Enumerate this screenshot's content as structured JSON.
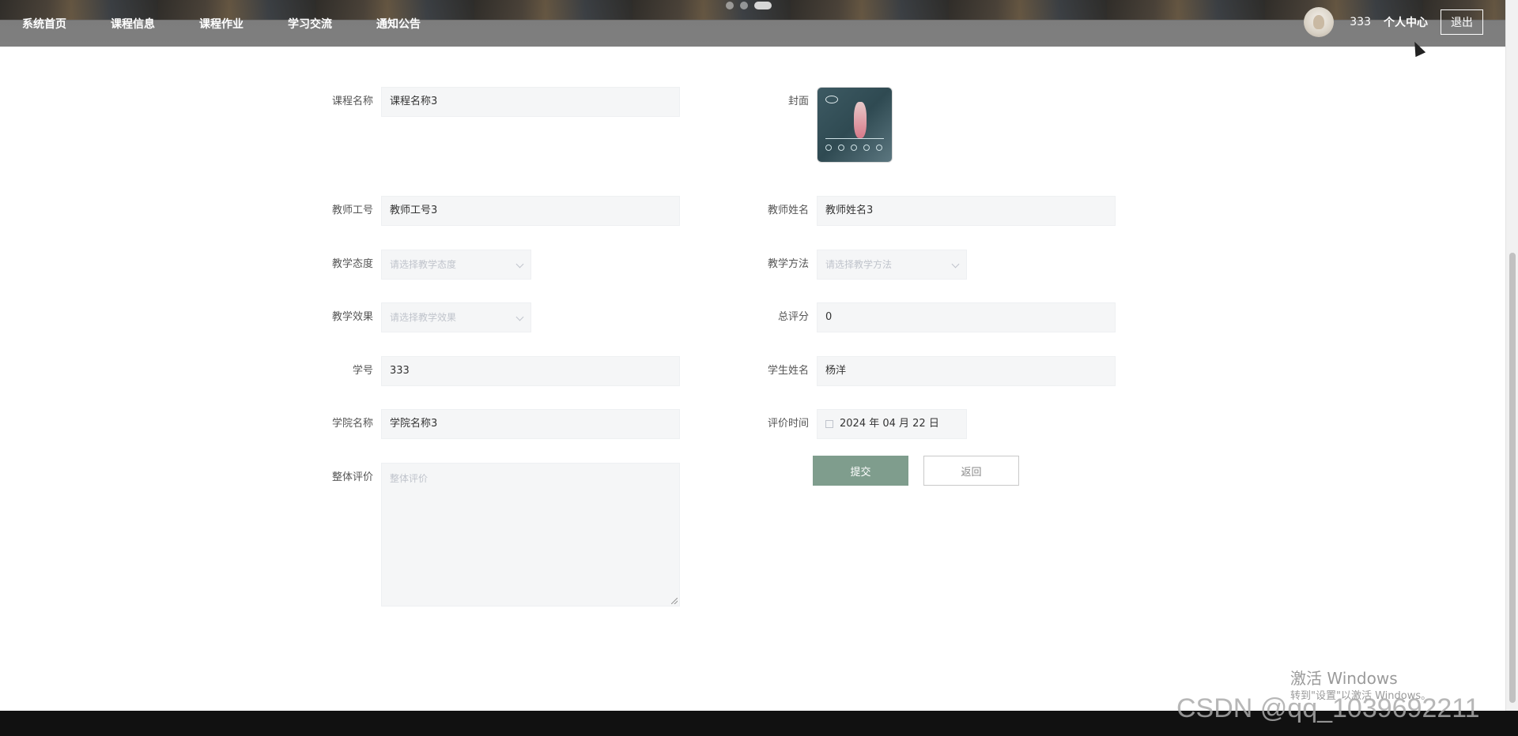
{
  "nav": {
    "items": [
      "系统首页",
      "课程信息",
      "课程作业",
      "学习交流",
      "通知公告"
    ]
  },
  "user": {
    "name": "333",
    "center_label": "个人中心",
    "logout_label": "退出"
  },
  "form": {
    "course_name": {
      "label": "课程名称",
      "value": "课程名称3"
    },
    "cover": {
      "label": "封面"
    },
    "teacher_id": {
      "label": "教师工号",
      "value": "教师工号3"
    },
    "teacher_name": {
      "label": "教师姓名",
      "value": "教师姓名3"
    },
    "teaching_attitude": {
      "label": "教学态度",
      "placeholder": "请选择教学态度"
    },
    "teaching_method": {
      "label": "教学方法",
      "placeholder": "请选择教学方法"
    },
    "teaching_effect": {
      "label": "教学效果",
      "placeholder": "请选择教学效果"
    },
    "total_score": {
      "label": "总评分",
      "value": "0"
    },
    "student_id": {
      "label": "学号",
      "value": "333"
    },
    "student_name": {
      "label": "学生姓名",
      "value": "杨洋"
    },
    "college_name": {
      "label": "学院名称",
      "value": "学院名称3"
    },
    "eval_time": {
      "label": "评价时间",
      "value": "2024 年 04 月 22 日"
    },
    "overall_eval": {
      "label": "整体评价",
      "placeholder": "整体评价"
    },
    "submit_label": "提交",
    "back_label": "返回"
  },
  "overlay": {
    "activate_title": "激活 Windows",
    "activate_sub": "转到\"设置\"以激活 Windows。",
    "watermark": "CSDN @qq_1039692211"
  },
  "colors": {
    "submit_bg": "#7f9d8d",
    "topbar": "#7f7f7f",
    "input_bg": "#f5f6f7"
  }
}
